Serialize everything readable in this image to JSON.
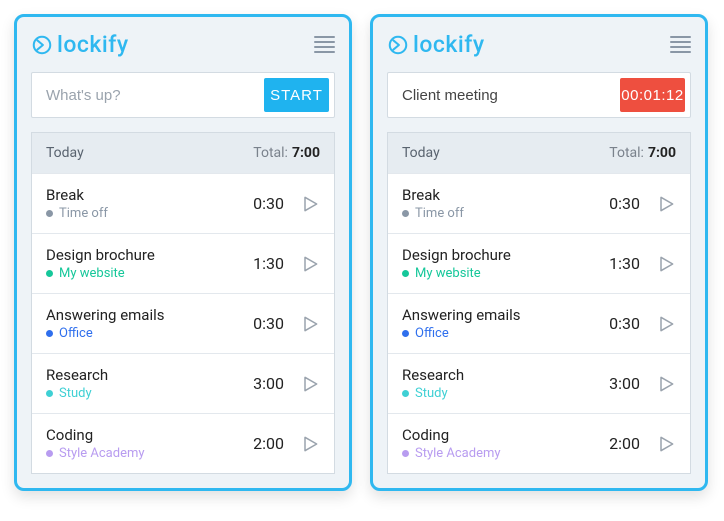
{
  "brand": "lockify",
  "panels": [
    {
      "inputValue": "",
      "inputPlaceholder": "What's up?",
      "action": {
        "kind": "start",
        "label": "START"
      }
    },
    {
      "inputValue": "Client meeting",
      "inputPlaceholder": "",
      "action": {
        "kind": "timer",
        "label": "00:01:12"
      }
    }
  ],
  "today": {
    "label": "Today",
    "totalLabel": "Total:",
    "totalValue": "7:00",
    "entries": [
      {
        "title": "Break",
        "project": "Time off",
        "color": "#8a97a6",
        "time": "0:30"
      },
      {
        "title": "Design brochure",
        "project": "My website",
        "color": "#16c79a",
        "time": "1:30"
      },
      {
        "title": "Answering emails",
        "project": "Office",
        "color": "#2f6fed",
        "time": "0:30"
      },
      {
        "title": "Research",
        "project": "Study",
        "color": "#3fd0d4",
        "time": "3:00"
      },
      {
        "title": "Coding",
        "project": "Style Academy",
        "color": "#b89cf0",
        "time": "2:00"
      }
    ]
  }
}
